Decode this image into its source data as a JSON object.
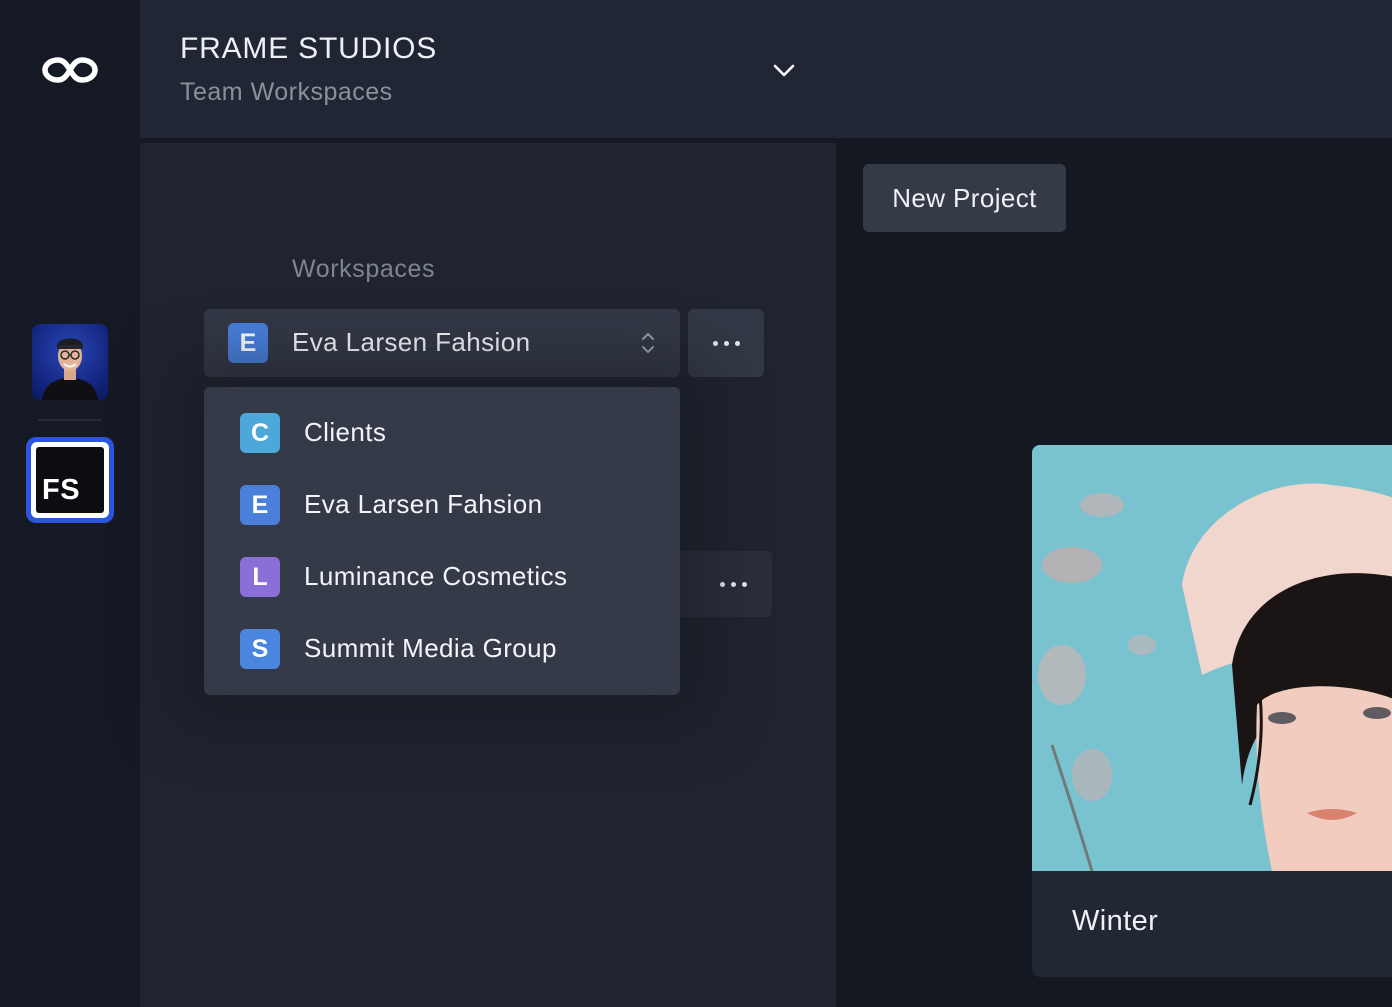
{
  "header": {
    "title": "FRAME STUDIOS",
    "subtitle": "Team Workspaces"
  },
  "rail": {
    "logo_icon": "infinity-logo-icon",
    "workspace_initials": "FS"
  },
  "panel": {
    "section_label": "Workspaces",
    "selected_workspace": {
      "initial": "E",
      "name": "Eva Larsen Fahsion",
      "color": "#4a7fdc"
    },
    "dropdown_items": [
      {
        "initial": "C",
        "name": "Clients",
        "color": "#4ba8d8"
      },
      {
        "initial": "E",
        "name": "Eva Larsen Fahsion",
        "color": "#4a7fdc"
      },
      {
        "initial": "L",
        "name": "Luminance Cosmetics",
        "color": "#8a6fd8"
      },
      {
        "initial": "S",
        "name": "Summit Media Group",
        "color": "#4a86e0"
      }
    ]
  },
  "main": {
    "new_project_label": "New Project",
    "card": {
      "title": "Winter"
    }
  },
  "colors": {
    "accent": "#2a56e0",
    "background": "#141821",
    "panel": "#20242f"
  }
}
